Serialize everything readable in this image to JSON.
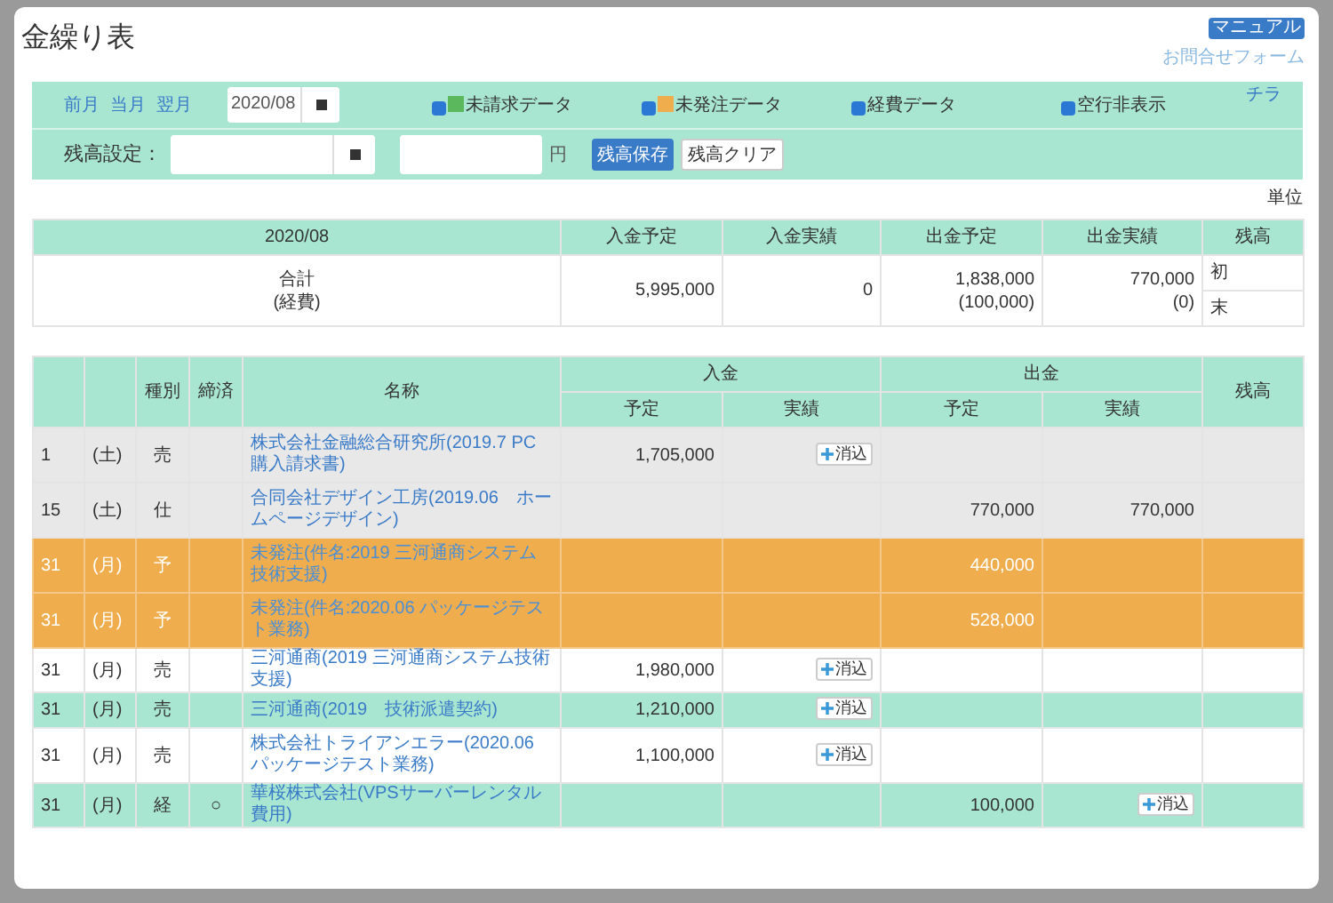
{
  "title": "金繰り表",
  "top_links": {
    "button": "マニュアル",
    "form_link": "お問合せフォーム",
    "sub_link": "チラ"
  },
  "nav": [
    "前月",
    "当月",
    "翌月"
  ],
  "month_field": {
    "value": "2020/08"
  },
  "filters": [
    {
      "label": "未請求データ",
      "checked": true,
      "color": "#5cb85c"
    },
    {
      "label": "未発注データ",
      "checked": true,
      "color": "#f0ad4e"
    },
    {
      "label": "経費データ",
      "checked": true
    },
    {
      "label": "空行非表示",
      "checked": true
    }
  ],
  "balance": {
    "label": "残高設定：",
    "unit": "円",
    "save": "残高保存",
    "clear": "残高クリア"
  },
  "unit_note": "単位",
  "summary": {
    "columns": [
      "2020/08",
      "入金予定",
      "入金実績",
      "出金予定",
      "出金実績",
      "残高"
    ],
    "label": "合計",
    "sublabel": "(経費)",
    "in_plan": "5,995,000",
    "in_actual": "0",
    "out_plan": "1,838,000",
    "out_plan_sub": "(100,000)",
    "out_actual": "770,000",
    "out_actual_sub": "(0)",
    "balance_rows": [
      "初",
      "末"
    ]
  },
  "table": {
    "columns": [
      "種別",
      "締済",
      "名称",
      "入金",
      "出金",
      "残高"
    ],
    "subcolumns": [
      "予定",
      "実績",
      "予定",
      "実績"
    ],
    "rows": [
      {
        "kind": "gray",
        "day": "1",
        "weekday": "(土)",
        "type": "売",
        "closed": "",
        "name": "株式会社金融総合研究所(2019.7 PC購入請求書)",
        "in_plan": "1,705,000",
        "in_actual_button": "消込",
        "out_plan": "",
        "out_actual": "",
        "out_actual_button": ""
      },
      {
        "kind": "gray",
        "day": "15",
        "weekday": "(土)",
        "type": "仕",
        "closed": "",
        "name": "合同会社デザイン工房(2019.06　ホームページデザイン)",
        "in_plan": "",
        "in_actual_button": "",
        "out_plan": "770,000",
        "out_actual": "770,000",
        "out_actual_button": ""
      },
      {
        "kind": "orange",
        "day": "31",
        "weekday": "(月)",
        "type": "予",
        "closed": "",
        "name": "未発注(件名:2019 三河通商システム技術支援)",
        "in_plan": "",
        "in_actual_button": "",
        "out_plan": "440,000",
        "out_actual": "",
        "out_actual_button": ""
      },
      {
        "kind": "orange",
        "day": "31",
        "weekday": "(月)",
        "type": "予",
        "closed": "",
        "name": "未発注(件名:2020.06 パッケージテスト業務)",
        "in_plan": "",
        "in_actual_button": "",
        "out_plan": "528,000",
        "out_actual": "",
        "out_actual_button": ""
      },
      {
        "kind": "white",
        "day": "31",
        "weekday": "(月)",
        "type": "売",
        "closed": "",
        "name": "三河通商(2019 三河通商システム技術支援)",
        "in_plan": "1,980,000",
        "in_actual_button": "消込",
        "out_plan": "",
        "out_actual": "",
        "out_actual_button": ""
      },
      {
        "kind": "green",
        "day": "31",
        "weekday": "(月)",
        "type": "売",
        "closed": "",
        "name": "三河通商(2019　技術派遣契約)",
        "in_plan": "1,210,000",
        "in_actual_button": "消込",
        "out_plan": "",
        "out_actual": "",
        "out_actual_button": ""
      },
      {
        "kind": "white",
        "day": "31",
        "weekday": "(月)",
        "type": "売",
        "closed": "",
        "name": "株式会社トライアンエラー(2020.06 パッケージテスト業務)",
        "in_plan": "1,100,000",
        "in_actual_button": "消込",
        "out_plan": "",
        "out_actual": "",
        "out_actual_button": ""
      },
      {
        "kind": "green",
        "day": "31",
        "weekday": "(月)",
        "type": "経",
        "closed": "○",
        "name": "華桜株式会社(VPSサーバーレンタル費用)",
        "in_plan": "",
        "in_actual_button": "",
        "out_plan": "100,000",
        "out_actual": "",
        "out_actual_button": "消込"
      }
    ]
  }
}
